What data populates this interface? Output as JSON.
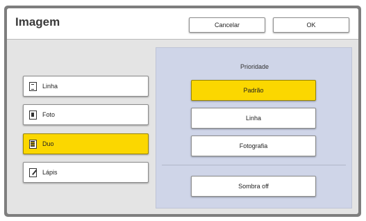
{
  "dialog": {
    "title": "Imagem",
    "cancel_label": "Cancelar",
    "ok_label": "OK"
  },
  "modes": [
    {
      "label": "Linha",
      "icon": "text-lines-icon",
      "selected": false
    },
    {
      "label": "Foto",
      "icon": "photo-icon",
      "selected": false
    },
    {
      "label": "Duo",
      "icon": "duo-icon",
      "selected": true
    },
    {
      "label": "Lápis",
      "icon": "pencil-icon",
      "selected": false
    }
  ],
  "priority": {
    "label": "Prioridade",
    "options": [
      {
        "label": "Padrão",
        "selected": true
      },
      {
        "label": "Linha",
        "selected": false
      },
      {
        "label": "Fotografia",
        "selected": false
      }
    ]
  },
  "shadow_button_label": "Sombra off",
  "colors": {
    "selected": "#fbd700",
    "panel": "#cfd5e8",
    "dialog_bg": "#e4e4e4",
    "frame": "#7e7e7e"
  }
}
